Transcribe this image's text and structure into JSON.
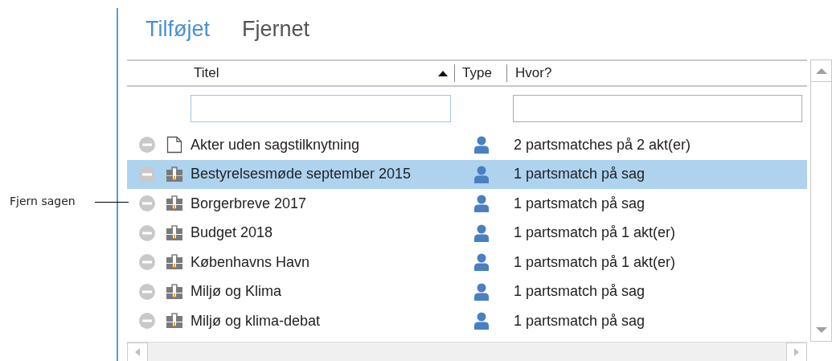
{
  "callout": {
    "text": "Fjern sagen"
  },
  "tabs": [
    {
      "label": "Tilføjet",
      "selected": true
    },
    {
      "label": "Fjernet",
      "selected": false
    }
  ],
  "table": {
    "columns": [
      {
        "label": "Titel",
        "sorted": true
      },
      {
        "label": "Type",
        "sorted": false
      },
      {
        "label": "Hvor?",
        "sorted": false
      }
    ],
    "rows": [
      {
        "kind": "document",
        "title": "Akter uden sagstilknytning",
        "where": "2 partsmatches på 2 akt(er)",
        "selected": false
      },
      {
        "kind": "case",
        "title": "Bestyrelsesmøde september 2015",
        "where": "1 partsmatch på sag",
        "selected": true
      },
      {
        "kind": "case",
        "title": "Borgerbreve 2017",
        "where": "1 partsmatch på sag",
        "selected": false
      },
      {
        "kind": "case",
        "title": "Budget 2018",
        "where": "1 partsmatch på 1 akt(er)",
        "selected": false
      },
      {
        "kind": "case",
        "title": "Københavns Havn",
        "where": "1 partsmatch på 1 akt(er)",
        "selected": false
      },
      {
        "kind": "case",
        "title": "Miljø og Klima",
        "where": "1 partsmatch på sag",
        "selected": false
      },
      {
        "kind": "case",
        "title": "Miljø og klima-debat",
        "where": "1 partsmatch på sag",
        "selected": false
      }
    ]
  }
}
